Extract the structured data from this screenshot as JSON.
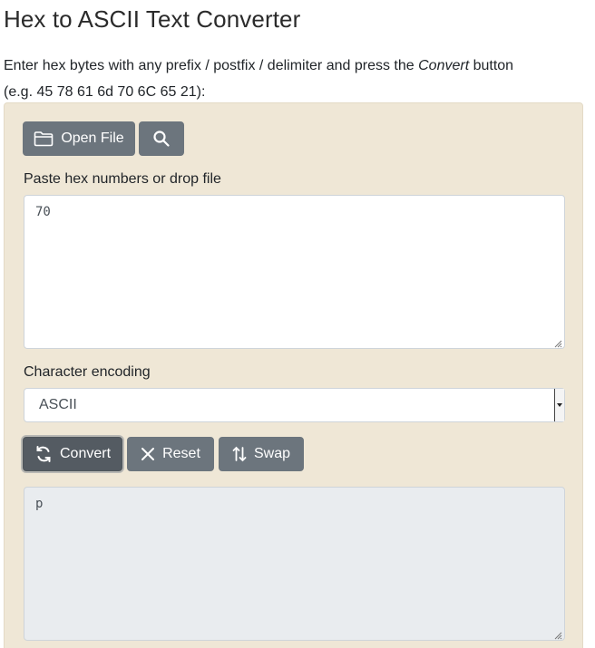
{
  "page": {
    "title": "Hex to ASCII Text Converter",
    "intro_before": "Enter hex bytes with any prefix / postfix / delimiter and press the ",
    "intro_em": "Convert",
    "intro_after": " button",
    "intro_example": "(e.g. 45 78 61 6d 70 6C 65 21):"
  },
  "toolbar": {
    "open_file_label": "Open File",
    "open_file_icon": "folder-icon",
    "search_icon": "search-icon"
  },
  "input": {
    "label": "Paste hex numbers or drop file",
    "value": "70"
  },
  "encoding": {
    "label": "Character encoding",
    "selected": "ASCII"
  },
  "actions": {
    "convert_label": "Convert",
    "reset_label": "Reset",
    "swap_label": "Swap",
    "convert_icon": "refresh-icon",
    "reset_icon": "close-icon",
    "swap_icon": "swap-icon"
  },
  "output": {
    "value": "p"
  },
  "colors": {
    "panel_bg": "#efe7d6",
    "button_bg": "#6c757d",
    "button_active_bg": "#545b62",
    "output_bg": "#e9ecef"
  }
}
